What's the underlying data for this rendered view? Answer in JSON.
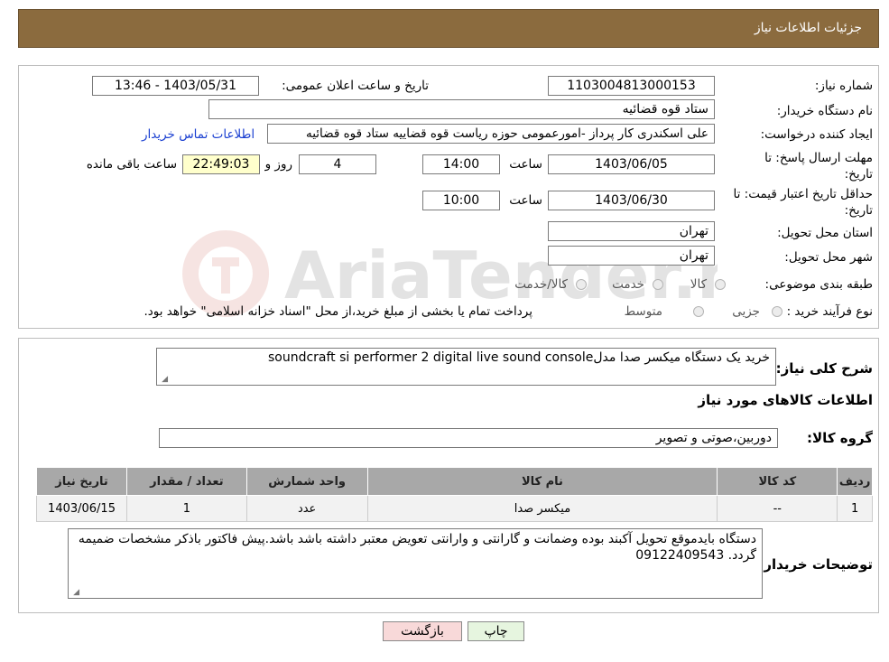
{
  "header": {
    "title": "جزئیات اطلاعات نیاز"
  },
  "watermark": {
    "text": "AriaTender.neT"
  },
  "form": {
    "need_number_label": "شماره نیاز:",
    "need_number": "1103004813000153",
    "announce_label": "تاریخ و ساعت اعلان عمومی:",
    "announce_value": "1403/05/31 - 13:46",
    "buyer_org_label": "نام دستگاه خریدار:",
    "buyer_org": "ستاد قوه قضائیه",
    "creator_label": "ایجاد کننده درخواست:",
    "creator": "علی اسکندری کار پرداز -امورعمومی حوزه ریاست قوه قضاییه ستاد قوه قضائیه",
    "contact_link": "اطلاعات تماس خریدار",
    "deadline_label_1": "مهلت ارسال پاسخ: تا",
    "deadline_label_2": "تاریخ:",
    "deadline_date": "1403/06/05",
    "time_label": "ساعت",
    "deadline_time": "14:00",
    "days_value": "4",
    "days_label": "روز و",
    "remaining_time": "22:49:03",
    "remaining_label": "ساعت باقی مانده",
    "validity_label_1": "حداقل تاریخ اعتبار قیمت: تا",
    "validity_label_2": "تاریخ:",
    "validity_date": "1403/06/30",
    "validity_time": "10:00",
    "province_label": "استان محل تحویل:",
    "province": "تهران",
    "city_label": "شهر محل تحویل:",
    "city": "تهران",
    "category_label": "طبقه بندی موضوعی:",
    "category_options": [
      "کالا",
      "خدمت",
      "کالا/خدمت"
    ],
    "purchase_type_label": "نوع فرآیند خرید :",
    "purchase_options": [
      "جزیی",
      "متوسط"
    ],
    "purchase_note": "پرداخت تمام یا بخشی از مبلغ خرید،از محل \"اسناد خزانه اسلامی\" خواهد بود."
  },
  "details": {
    "summary_label": "شرح کلی نیاز:",
    "summary": "خرید یک دستگاه میکسر صدا مدلsoundcraft si performer 2 digital live sound console",
    "goods_info_title": "اطلاعات کالاهای مورد نیاز",
    "goods_group_label": "گروه کالا:",
    "goods_group": "دوربین،صوتی و تصویر",
    "table_headers": [
      "ردیف",
      "کد کالا",
      "نام کالا",
      "واحد شمارش",
      "تعداد / مقدار",
      "تاریخ نیاز"
    ],
    "table_rows": [
      [
        "1",
        "--",
        "میکسر صدا",
        "عدد",
        "1",
        "1403/06/15"
      ]
    ],
    "buyer_notes_label": "توضیحات خریدار:",
    "buyer_notes": "دستگاه بایدموقع تحویل آکبند بوده وضمانت و گارانتی و وارانتی تعویض معتبر داشته باشد باشد.پیش فاکتور باذکر مشخصات ضمیمه گردد. 09122409543"
  },
  "buttons": {
    "print": "چاپ",
    "back": "بازگشت"
  },
  "colors": {
    "header_bg": "#8B6B3E",
    "link": "#1a3fd1",
    "remaining_bg": "#ffffcc",
    "back_btn_bg": "#f8d9d9",
    "print_btn_bg": "#e6f5df"
  }
}
